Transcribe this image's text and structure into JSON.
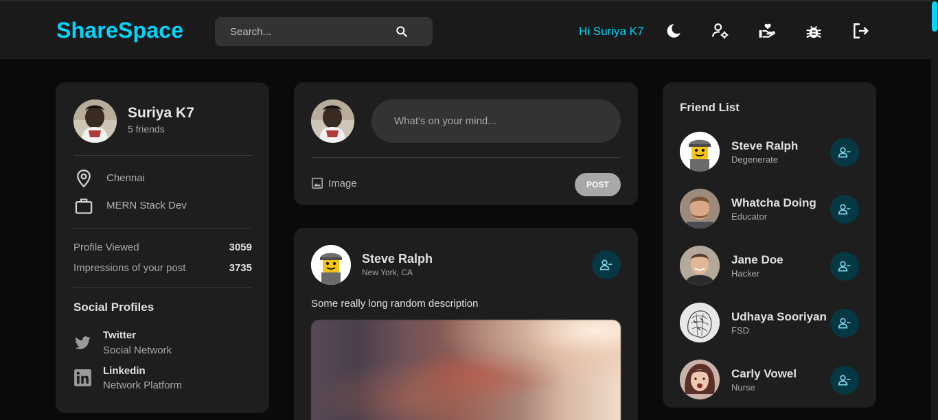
{
  "brand": {
    "name": "ShareSpace",
    "accent": "#00d5fa"
  },
  "search": {
    "placeholder": "Search..."
  },
  "header": {
    "greeting": "Hi Suriya K7",
    "icons": [
      "moon-icon",
      "user-settings-icon",
      "donate-icon",
      "bug-icon",
      "logout-icon"
    ]
  },
  "profile": {
    "name": "Suriya K7",
    "friends": "5 friends",
    "location": "Chennai",
    "occupation": "MERN Stack Dev",
    "stats": [
      {
        "label": "Profile Viewed",
        "value": "3059"
      },
      {
        "label": "Impressions of your post",
        "value": "3735"
      }
    ],
    "social_title": "Social Profiles",
    "socials": [
      {
        "name": "Twitter",
        "sub": "Social Network",
        "icon": "twitter-icon"
      },
      {
        "name": "Linkedin",
        "sub": "Network Platform",
        "icon": "linkedin-icon"
      }
    ]
  },
  "composer": {
    "placeholder": "What's on your mind...",
    "image_label": "Image",
    "post_label": "POST"
  },
  "post": {
    "author": "Steve Ralph",
    "location": "New York, CA",
    "description": "Some really long random description"
  },
  "friend_list": {
    "title": "Friend List",
    "friends": [
      {
        "name": "Steve Ralph",
        "role": "Degenerate"
      },
      {
        "name": "Whatcha Doing",
        "role": "Educator"
      },
      {
        "name": "Jane Doe",
        "role": "Hacker"
      },
      {
        "name": "Udhaya Sooriyan",
        "role": "FSD"
      },
      {
        "name": "Carly Vowel",
        "role": "Nurse"
      }
    ]
  }
}
